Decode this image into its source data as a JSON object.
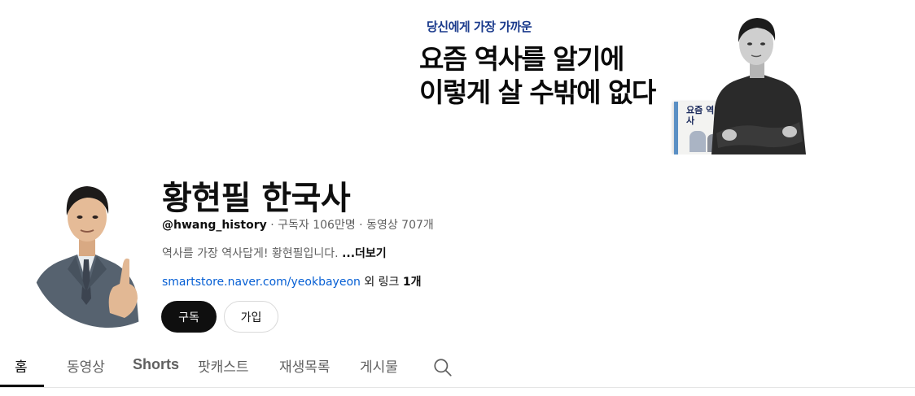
{
  "banner": {
    "tagline": "당신에게 가장 가까운",
    "headline_line1": "요즘 역사를 알기에",
    "headline_line2": "이렇게 살 수밖에 없다",
    "book_title": "요즘 역사"
  },
  "channel": {
    "title": "황현필 한국사",
    "handle": "@hwang_history",
    "subscribers": "구독자 106만명",
    "videos": "동영상 707개",
    "separator": "·",
    "description": "역사를 가장 역사답게! 황현필입니다.",
    "more_label": "...더보기",
    "link_text": "smartstore.naver.com/yeokbayeon",
    "link_extra_prefix": "외 링크",
    "link_extra_count": "1개"
  },
  "buttons": {
    "subscribe": "구독",
    "join": "가입"
  },
  "tabs": [
    {
      "label": "홈",
      "active": true
    },
    {
      "label": "동영상",
      "active": false
    },
    {
      "label": "Shorts",
      "active": false
    },
    {
      "label": "팟캐스트",
      "active": false
    },
    {
      "label": "재생목록",
      "active": false
    },
    {
      "label": "게시물",
      "active": false
    }
  ],
  "icons": {
    "search": "search-icon"
  },
  "colors": {
    "link": "#065fd4",
    "tagline": "#1a3a8c",
    "subscribe_bg": "#0f0f0f",
    "secondary_text": "#606060"
  }
}
